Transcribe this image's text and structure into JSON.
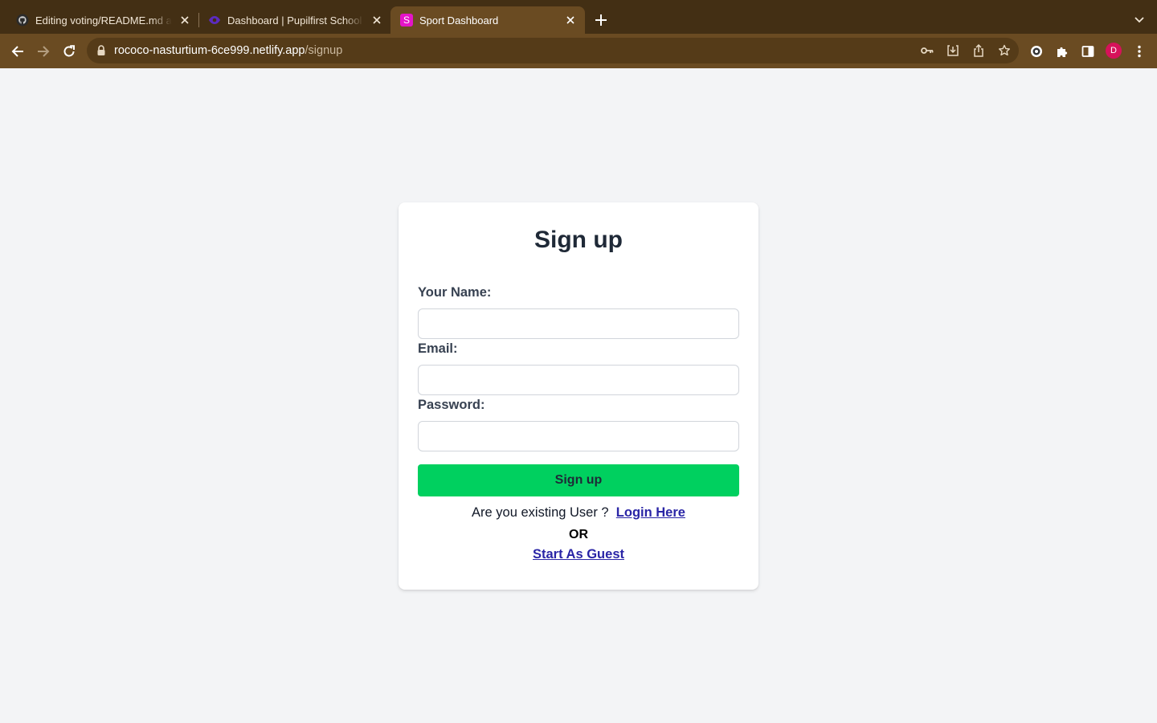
{
  "browser": {
    "tabs": [
      {
        "title": "Editing voting/README.md at m",
        "icon": "github-icon"
      },
      {
        "title": "Dashboard | Pupilfirst School | ",
        "icon": "pupilfirst-icon"
      },
      {
        "title": "Sport Dashboard",
        "icon": "sport-dashboard-icon",
        "favicon_letter": "S",
        "active": true
      }
    ],
    "url_host": "rococo-nasturtium-6ce999.netlify.app",
    "url_path": "/signup",
    "profile_initial": "D"
  },
  "colors": {
    "tabbar_bg": "#432f14",
    "toolbar_bg": "#6a4b22",
    "page_bg": "#f3f4f6",
    "accent_green": "#00d05f",
    "link": "#2a25a6",
    "favicon_magenta": "#e414c8",
    "avatar_pink": "#d6125a"
  },
  "form": {
    "title": "Sign up",
    "fields": [
      {
        "label": "Your Name:",
        "value": "",
        "placeholder": ""
      },
      {
        "label": "Email:",
        "value": "",
        "placeholder": ""
      },
      {
        "label": "Password:",
        "value": "",
        "placeholder": ""
      }
    ],
    "submit_label": "Sign up",
    "existing_user_text": "Are you existing User ?",
    "login_link": "Login Here",
    "or_text": "OR",
    "guest_link": "Start As Guest"
  }
}
